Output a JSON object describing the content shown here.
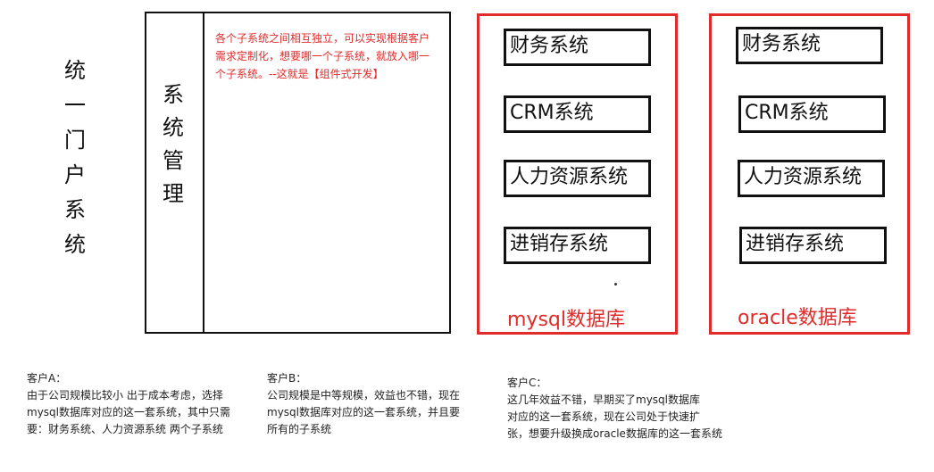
{
  "portal": {
    "chars": [
      "统",
      "一",
      "门",
      "户",
      "系",
      "统"
    ]
  },
  "system_management": {
    "chars": [
      "系",
      "统",
      "管",
      "理"
    ]
  },
  "note_lines": [
    "各个子系统之间相互独立，可以实现根据客户",
    "需求定制化，想要哪一个子系统，就放入哪一",
    "个子系统。--这就是【组件式开发】"
  ],
  "mysql_group": {
    "title": "mysql数据库",
    "systems": [
      "财务系统",
      "CRM系统",
      "人力资源系统",
      "进销存系统"
    ]
  },
  "oracle_group": {
    "title": "oracle数据库",
    "systems": [
      "财务系统",
      "CRM系统",
      "人力资源系统",
      "进销存系统"
    ]
  },
  "customers": [
    {
      "title": "客户A：",
      "lines": [
        "由于公司规模比较小   出于成本考虑，选择",
        "mysql数据库对应的这一套系统，其中只需",
        "要：财务系统、人力资源系统 两个子系统"
      ]
    },
    {
      "title": "客户B：",
      "lines": [
        "公司规模是中等规模，效益也不错，现在",
        "mysql数据库对应的这一套系统，并且要",
        "所有的子系统"
      ]
    },
    {
      "title": "客户C：",
      "lines": [
        "这几年效益不错，早期买了mysql数据库",
        "对应的这一套系统，现在公司处于快速扩",
        "张，想要升级换成oracle数据库的这一套系统"
      ]
    }
  ]
}
